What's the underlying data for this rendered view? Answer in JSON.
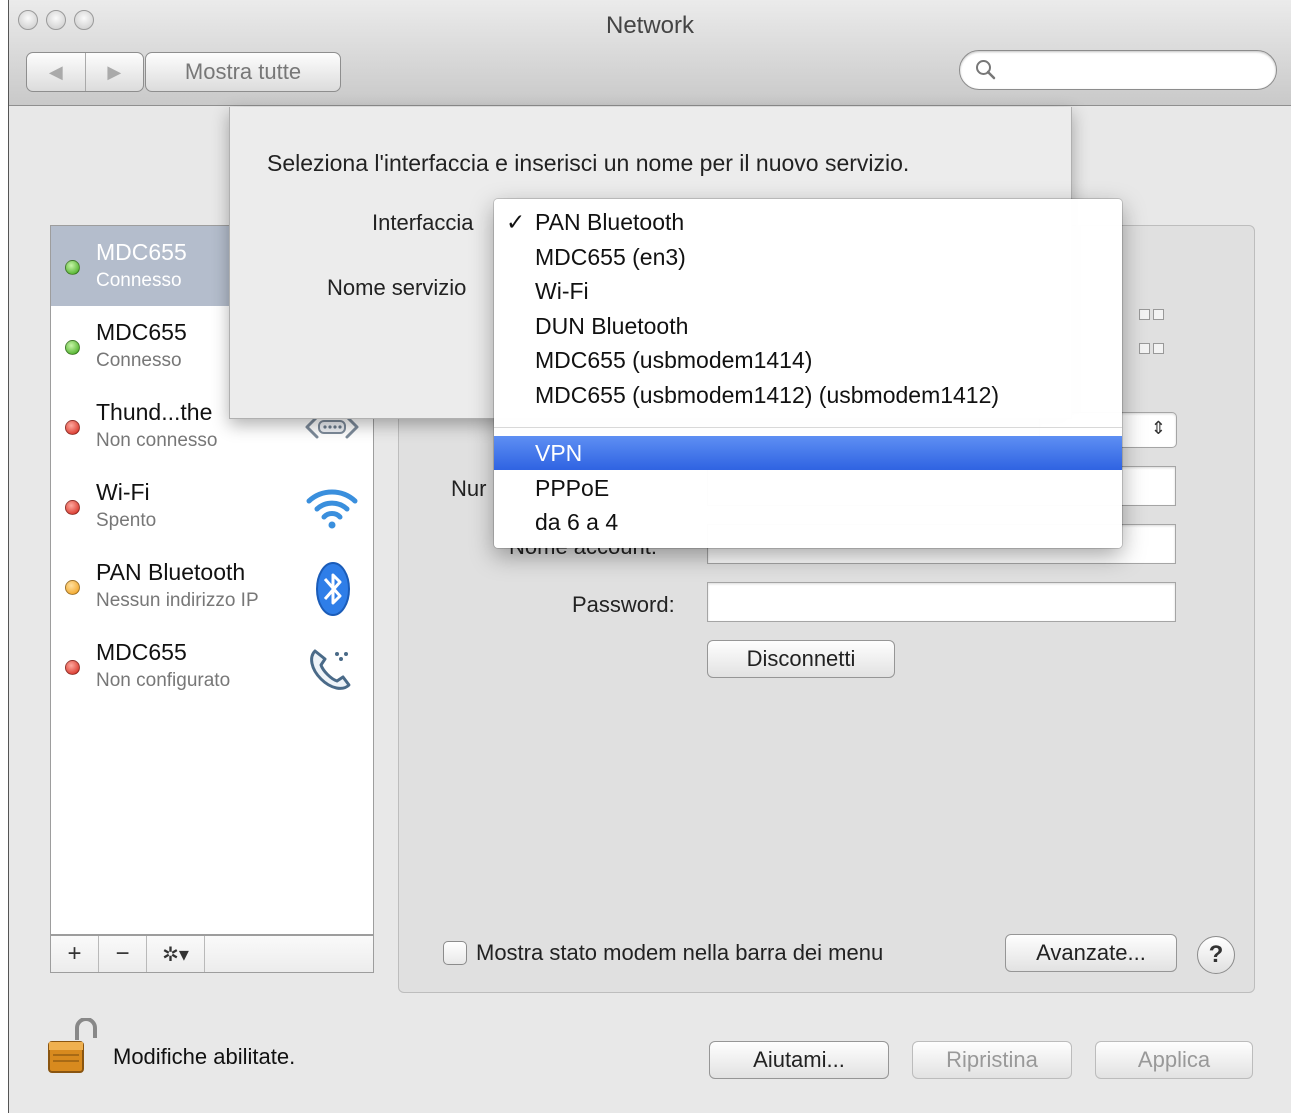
{
  "window": {
    "title": "Network"
  },
  "toolbar": {
    "show_all": "Mostra tutte",
    "search_placeholder": ""
  },
  "services": [
    {
      "name": "MDC655",
      "status": "Connesso",
      "status_color": "green",
      "selected": true,
      "icon": "arrows-icon"
    },
    {
      "name": "MDC655",
      "status": "Connesso",
      "status_color": "green",
      "selected": false,
      "icon": "arrows-icon"
    },
    {
      "name": "Thund...the",
      "status": "Non connesso",
      "status_color": "red",
      "selected": false,
      "icon": "ethernet-icon"
    },
    {
      "name": "Wi-Fi",
      "status": "Spento",
      "status_color": "red",
      "selected": false,
      "icon": "wifi-icon"
    },
    {
      "name": "PAN Bluetooth",
      "status": "Nessun indirizzo IP",
      "status_color": "orange",
      "selected": false,
      "icon": "bluetooth-icon"
    },
    {
      "name": "MDC655",
      "status": "Non configurato",
      "status_color": "red",
      "selected": false,
      "icon": "phone-icon"
    }
  ],
  "list_toolbar": {
    "add": "+",
    "remove": "−",
    "gear": "✲▾"
  },
  "details": {
    "number_label": "Nur",
    "account_label": "Nome account:",
    "password_label": "Password:",
    "disconnect_button": "Disconnetti",
    "show_modem_status": "Mostra stato modem nella barra dei menu",
    "show_modem_status_checked": false,
    "advanced_button": "Avanzate...",
    "help_button": "?"
  },
  "footer": {
    "lock_text": "Modifiche abilitate.",
    "assist_button": "Aiutami...",
    "revert_button": "Ripristina",
    "apply_button": "Applica"
  },
  "sheet": {
    "title": "Seleziona l'interfaccia e inserisci un nome per il nuovo servizio.",
    "interface_label": "Interfaccia",
    "service_name_label": "Nome servizio"
  },
  "interface_menu": {
    "checked": "PAN Bluetooth",
    "highlighted": "VPN",
    "group1": [
      "PAN Bluetooth",
      "MDC655 (en3)",
      "Wi-Fi",
      "DUN Bluetooth",
      "MDC655 (usbmodem1414)",
      "MDC655 (usbmodem1412) (usbmodem1412)"
    ],
    "group2": [
      "VPN",
      "PPPoE",
      "da 6 a 4"
    ]
  },
  "colors": {
    "menu_highlight": "#3a6fe8",
    "selected_row": "#b4bdcc",
    "status_green": "#34a20e",
    "status_red": "#d01e12",
    "status_orange": "#ef9a10"
  }
}
